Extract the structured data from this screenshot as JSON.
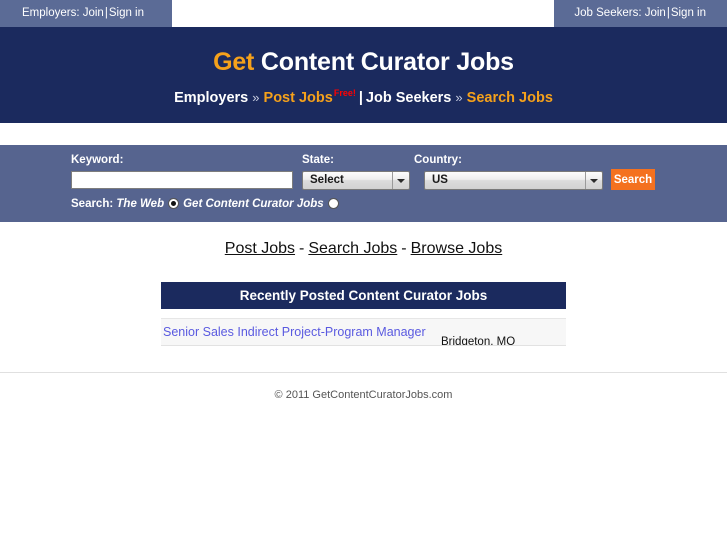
{
  "topbar": {
    "employers": {
      "prefix": "Employers:",
      "join": "Join",
      "separator": "|",
      "signin": "Sign in"
    },
    "jobseekers": {
      "prefix": "Job Seekers:",
      "join": "Join",
      "separator": "|",
      "signin": "Sign in"
    }
  },
  "masthead": {
    "title_highlight": "Get",
    "title_rest": " Content Curator Jobs",
    "nav": {
      "employers_label": "Employers",
      "chevron1": "»",
      "post_jobs": "Post Jobs",
      "free_badge": "Free!",
      "pipe": "|",
      "jobseekers_label": "Job Seekers",
      "chevron2": "»",
      "search_jobs": "Search Jobs"
    }
  },
  "search_panel": {
    "keyword_label": "Keyword:",
    "keyword_value": "",
    "keyword_placeholder": "",
    "state_label": "State:",
    "state_value": "Select",
    "state_options": [
      "Select"
    ],
    "country_label": "Country:",
    "country_value": "US",
    "country_options": [
      "US"
    ],
    "search_button": "Search",
    "scope_label": "Search:",
    "scope_option_web": "The Web",
    "scope_option_site": "Get Content Curator Jobs",
    "scope_selected": "The Web"
  },
  "midnav": {
    "post_jobs": "Post Jobs",
    "dash1": "-",
    "search_jobs": "Search Jobs",
    "dash2": "-",
    "browse_jobs": "Browse Jobs"
  },
  "recent_jobs": {
    "header": "Recently Posted Content Curator Jobs",
    "rows": [
      {
        "title": "Senior Sales Indirect Project-Program Manager",
        "location": "Bridgeton, MO"
      }
    ]
  },
  "footer": {
    "copyright": "© 2011 GetContentCuratorJobs.com"
  },
  "colors": {
    "navy": "#1b2a5e",
    "panel_blue": "#56648f",
    "tab_blue": "#5b6b96",
    "accent_orange": "#f5a11b",
    "button_orange": "#f4711f",
    "free_red": "#ff0000",
    "link_blue": "#5a5ae0"
  }
}
